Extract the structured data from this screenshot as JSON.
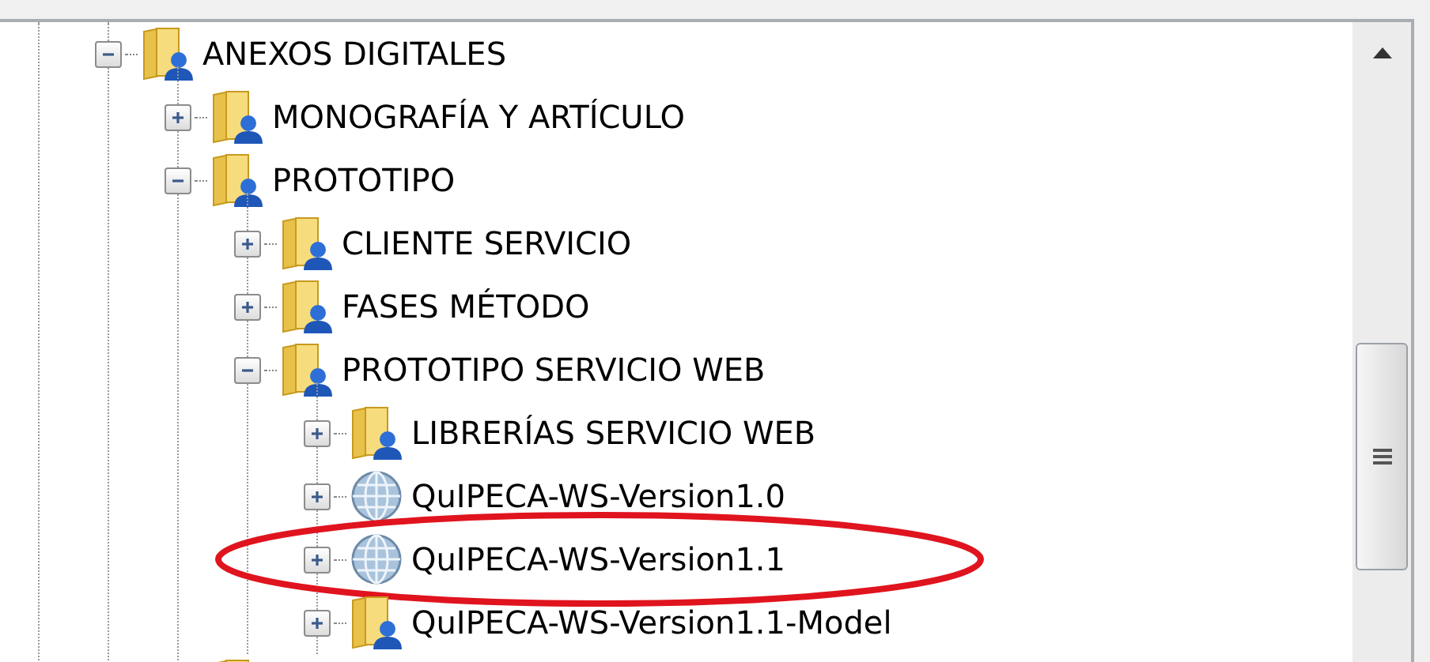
{
  "tree": [
    {
      "label": "ANEXOS DIGITALES",
      "kind": "folder",
      "expanded": true,
      "children": [
        {
          "label": "MONOGRAFÍA Y ARTÍCULO",
          "kind": "folder",
          "expanded": false
        },
        {
          "label": "PROTOTIPO",
          "kind": "folder",
          "expanded": true,
          "children": [
            {
              "label": "CLIENTE SERVICIO",
              "kind": "folder",
              "expanded": false
            },
            {
              "label": "FASES MÉTODO",
              "kind": "folder",
              "expanded": false
            },
            {
              "label": "PROTOTIPO SERVICIO WEB",
              "kind": "folder",
              "expanded": true,
              "children": [
                {
                  "label": "LIBRERÍAS SERVICIO WEB",
                  "kind": "folder",
                  "expanded": false
                },
                {
                  "label": "QuIPECA-WS-Version1.0",
                  "kind": "globe",
                  "expanded": false,
                  "circled": false
                },
                {
                  "label": "QuIPECA-WS-Version1.1",
                  "kind": "globe",
                  "expanded": false,
                  "circled": true
                },
                {
                  "label": "QuIPECA-WS-Version1.1-Model",
                  "kind": "folder",
                  "expanded": false,
                  "circled": false
                }
              ]
            }
          ]
        },
        {
          "kind": "folder"
        }
      ]
    }
  ]
}
